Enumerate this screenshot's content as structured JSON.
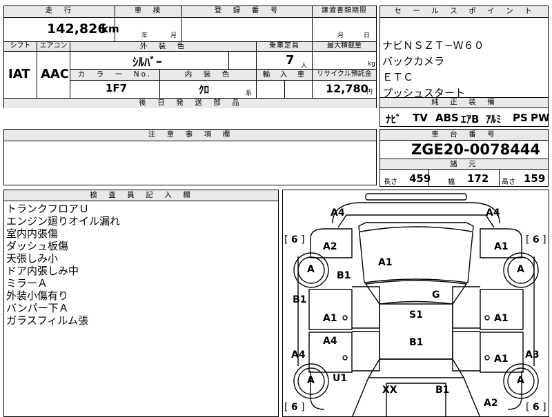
{
  "top_form": {
    "mileage_header": "走　行",
    "mileage_value": "142,826",
    "mileage_unit": "km",
    "inspection_header": "車　検",
    "inspection_year": "年",
    "inspection_month": "月",
    "registration_header": "登　録　番　号",
    "transfer_header": "譲渡書類期限",
    "transfer_month": "月",
    "transfer_day": "日",
    "shift_header": "シフト",
    "aircon_header": "エアコン",
    "exterior_color_header": "外　装　色",
    "capacity_header": "乗車定員",
    "max_load_header": "最大積載量",
    "shift_value": "IAT",
    "aircon_value": "AAC",
    "exterior_color_value": "ｼﾙﾊﾞｰ",
    "capacity_value": "7",
    "capacity_unit": "人",
    "max_load_unit": "kg",
    "color_no_header": "カ　ラ　ー　No.",
    "interior_color_header": "内　装　色",
    "import_header": "輸　入　車",
    "recycle_header": "リサイクル預託金",
    "color_no_value": "1F7",
    "interior_color_value": "ｸﾛ",
    "interior_color_suffix": "系",
    "recycle_value": "12,780",
    "recycle_unit": "円",
    "later_parts_header": "後　日　発　送　部　品"
  },
  "sales_points": {
    "header": "セ　ー　ル　ス　ポ　イ　ン　ト",
    "items": [
      "ナビＮＳＺＴ−Ｗ６０",
      "バックカメラ",
      "ＥＴＣ",
      "プッシュスタート"
    ]
  },
  "genuine_equipment": {
    "header": "純　正　装　備",
    "items": [
      "ﾅﾋﾞ",
      "TV",
      "ABS",
      "ｴｱB",
      "ｱﾙﾐ",
      "PS",
      "PW"
    ]
  },
  "notes": {
    "header": "注　意　事　項　欄"
  },
  "chassis": {
    "header": "車　台　番　号",
    "value": "ZGE20-0078444"
  },
  "specs": {
    "header": "諸　元",
    "length_label": "長さ",
    "length_value": "459",
    "width_label": "幅",
    "width_value": "172",
    "height_label": "高さ",
    "height_value": "159"
  },
  "inspector": {
    "header": "検　査　員　記　入　欄",
    "items": [
      "トランクフロアＵ",
      "エンジン廻りオイル漏れ",
      "室内内張傷",
      "ダッシュ板傷",
      "天張しみ小",
      "ドア内張しみ中",
      "ミラーＡ",
      "外装小傷有り",
      "バンパー下Ａ",
      "ガラスフィルム張"
    ]
  },
  "diagram": {
    "marks": {
      "a4_left_top": "A4",
      "a4_right_top": "A4",
      "a2_left": "A2",
      "a1_right_top": "A1",
      "a1_roof": "A1",
      "b1_left": "B1",
      "b1_pillar": "B1",
      "g_glass": "G",
      "a1_left_front_door": "A1",
      "s1_seat": "S1",
      "a1_right_front_door": "A1",
      "a4_left_rear_door": "A4",
      "b1_floor": "B1",
      "a4_left_lower": "A4",
      "a1_right_rear_door": "A1",
      "a3_right": "A3",
      "u1_left": "U1",
      "xx_rear": "XX",
      "b1_rear": "B1",
      "a2_right_bottom": "A2"
    },
    "tires": {
      "left_front": "A",
      "right_front": "A",
      "left_rear": "A",
      "right_rear": "A"
    },
    "tread": {
      "left_front": "6",
      "right_front": "6",
      "left_rear": "6",
      "right_rear": "6"
    }
  }
}
